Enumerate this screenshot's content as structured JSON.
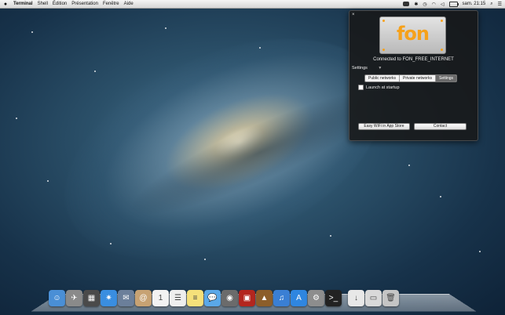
{
  "menubar": {
    "apple": "",
    "items": [
      "Terminal",
      "Shell",
      "Édition",
      "Présentation",
      "Fenêtre",
      "Aide"
    ],
    "clock": "sam. 21:15"
  },
  "panel": {
    "close": "×",
    "logo": "fon",
    "connected": "Connected to FON_FREE_INTERNET",
    "settings_title": "Settings",
    "tabs": [
      "Public networks",
      "Private networks",
      "Settings"
    ],
    "active_tab": "Settings",
    "launch_label": "Launch at startup",
    "appstore_button": "Easy WiFi in App Store",
    "contact_button": "Contact"
  },
  "dock": [
    {
      "name": "finder-icon",
      "color": "#4a8fd6",
      "glyph": "☺"
    },
    {
      "name": "launchpad-icon",
      "color": "#8a8a8a",
      "glyph": "✈"
    },
    {
      "name": "mission-control-icon",
      "color": "#4a4a4a",
      "glyph": "▦"
    },
    {
      "name": "safari-icon",
      "color": "#3a8ee0",
      "glyph": "✷"
    },
    {
      "name": "mail-icon",
      "color": "#6b7f9a",
      "glyph": "✉"
    },
    {
      "name": "contacts-icon",
      "color": "#c7a273",
      "glyph": "@"
    },
    {
      "name": "calendar-icon",
      "color": "#f2f2f2",
      "glyph": "1"
    },
    {
      "name": "reminders-icon",
      "color": "#eeeeee",
      "glyph": "☰"
    },
    {
      "name": "notes-icon",
      "color": "#f5e07a",
      "glyph": "≡"
    },
    {
      "name": "messages-icon",
      "color": "#5aa8e8",
      "glyph": "💬"
    },
    {
      "name": "facetime-icon",
      "color": "#6b6b6b",
      "glyph": "◉"
    },
    {
      "name": "photo-booth-icon",
      "color": "#b3261e",
      "glyph": "▣"
    },
    {
      "name": "iphoto-icon",
      "color": "#8c5e2a",
      "glyph": "▲"
    },
    {
      "name": "itunes-icon",
      "color": "#3a7fd4",
      "glyph": "♫"
    },
    {
      "name": "app-store-icon",
      "color": "#2f86e0",
      "glyph": "A"
    },
    {
      "name": "system-preferences-icon",
      "color": "#8d8d8d",
      "glyph": "⚙"
    },
    {
      "name": "terminal-icon",
      "color": "#222222",
      "glyph": ">_"
    },
    {
      "name": "downloads-icon",
      "color": "#e8e8e8",
      "glyph": "↓"
    },
    {
      "name": "documents-icon",
      "color": "#d9d9d9",
      "glyph": "▭"
    },
    {
      "name": "trash-icon",
      "color": "#c5c5c5",
      "glyph": "🗑"
    }
  ]
}
